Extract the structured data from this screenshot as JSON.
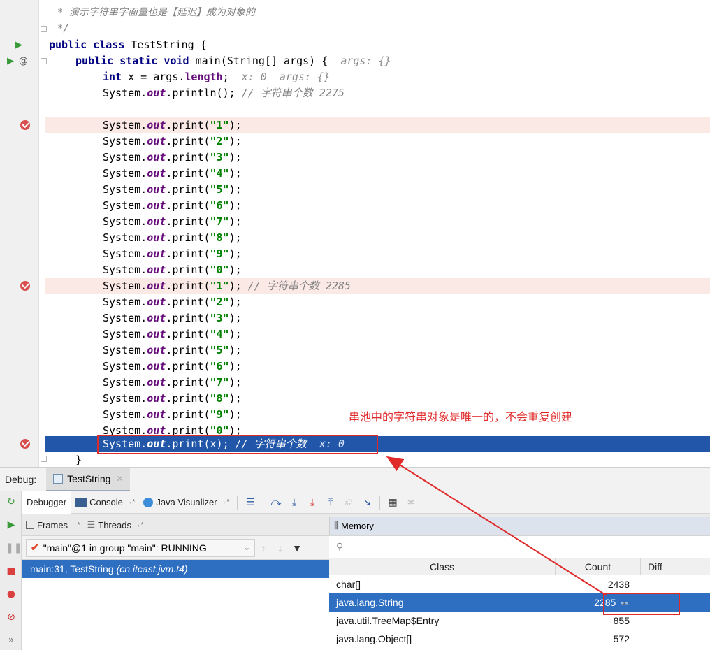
{
  "editor": {
    "doc_comment_line": "* 演示字符串字面量也是【延迟】成为对象的",
    "doc_comment_end": "*/",
    "class_decl": {
      "kw": "public class",
      "name": "TestString {"
    },
    "main_decl": {
      "kw": "public static void",
      "rest": "main(String[] args) {",
      "inline": "args: {}"
    },
    "int_line": {
      "kw": "int",
      "rest1": "x = args.",
      "field": "length",
      "rest2": ";",
      "inline": "x: 0  args: {}"
    },
    "println_line": {
      "a": "System.",
      "out": "out",
      "b": ".println(); ",
      "comment": "// 字符串个数 2275"
    },
    "print_lines_1": [
      "1",
      "2",
      "3",
      "4",
      "5",
      "6",
      "7",
      "8",
      "9",
      "0"
    ],
    "print_lines_2": [
      "1",
      "2",
      "3",
      "4",
      "5",
      "6",
      "7",
      "8",
      "9",
      "0"
    ],
    "second_block_comment": "// 字符串个数 2285",
    "final_line": {
      "a": "System.",
      "out": "out",
      "b": ".print(x); ",
      "comment": "// 字符串个数",
      "inline": "x: 0"
    },
    "closing_brace": "}",
    "print_parts": {
      "a": "System.",
      "out": "out",
      "b": ".print("
    }
  },
  "annotation": {
    "text": "串池中的字符串对象是唯一的，不会重复创建",
    "color": "#e02a2a"
  },
  "debug": {
    "label": "Debug:",
    "run_tab": "TestString",
    "tabs": {
      "debugger": "Debugger",
      "console": "Console",
      "console_pin": "→*",
      "visualizer": "Java Visualizer",
      "visualizer_pin": "→*"
    },
    "sub_tabs": {
      "frames": "Frames",
      "frames_pin": "→*",
      "threads": "Threads",
      "threads_pin": "→*",
      "memory": "Memory"
    },
    "thread_select": "\"main\"@1 in group \"main\": RUNNING",
    "frame": {
      "loc": "main:31, TestString",
      "pkg": "(cn.itcast.jvm.t4)"
    },
    "memory": {
      "columns": [
        "Class",
        "Count",
        "Diff"
      ],
      "rows": [
        {
          "cls": "char[]",
          "count": "2438"
        },
        {
          "cls": "java.lang.String",
          "count": "2285"
        },
        {
          "cls": "java.util.TreeMap$Entry",
          "count": "855"
        },
        {
          "cls": "java.lang.Object[]",
          "count": "572"
        }
      ]
    }
  }
}
